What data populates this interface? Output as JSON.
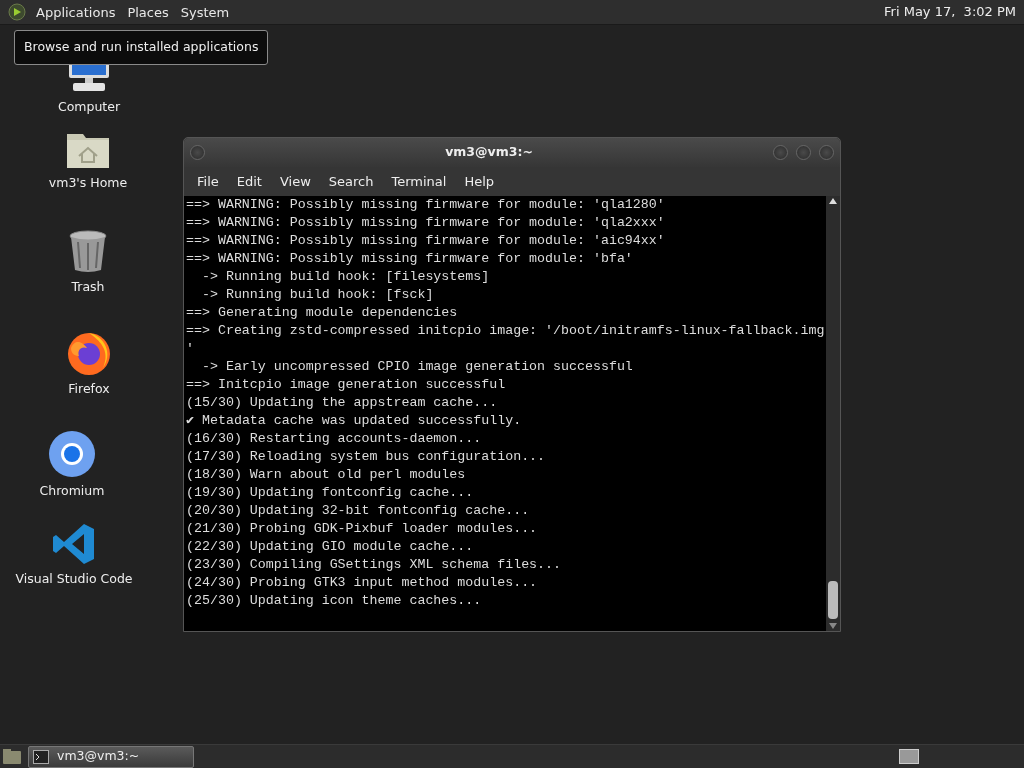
{
  "top_panel": {
    "menus": [
      "Applications",
      "Places",
      "System"
    ],
    "clock": "Fri May 17,  3:02 PM"
  },
  "tooltip": "Browse and run installed applications",
  "desktop_icons": [
    {
      "kind": "computer",
      "label": "Computer"
    },
    {
      "kind": "home",
      "label": "vm3's Home"
    },
    {
      "kind": "trash",
      "label": "Trash"
    },
    {
      "kind": "firefox",
      "label": "Firefox"
    },
    {
      "kind": "chromium",
      "label": "Chromium"
    },
    {
      "kind": "vscode",
      "label": "Visual Studio Code"
    }
  ],
  "terminal": {
    "title": "vm3@vm3:~",
    "menu": [
      "File",
      "Edit",
      "View",
      "Search",
      "Terminal",
      "Help"
    ],
    "lines": [
      "==> WARNING: Possibly missing firmware for module: 'qla1280'",
      "==> WARNING: Possibly missing firmware for module: 'qla2xxx'",
      "==> WARNING: Possibly missing firmware for module: 'aic94xx'",
      "==> WARNING: Possibly missing firmware for module: 'bfa'",
      "  -> Running build hook: [filesystems]",
      "  -> Running build hook: [fsck]",
      "==> Generating module dependencies",
      "==> Creating zstd-compressed initcpio image: '/boot/initramfs-linux-fallback.img",
      "'",
      "  -> Early uncompressed CPIO image generation successful",
      "==> Initcpio image generation successful",
      "(15/30) Updating the appstream cache...",
      "✔ Metadata cache was updated successfully.",
      "(16/30) Restarting accounts-daemon...",
      "(17/30) Reloading system bus configuration...",
      "(18/30) Warn about old perl modules",
      "(19/30) Updating fontconfig cache...",
      "(20/30) Updating 32-bit fontconfig cache...",
      "(21/30) Probing GDK-Pixbuf loader modules...",
      "(22/30) Updating GIO module cache...",
      "(23/30) Compiling GSettings XML schema files...",
      "(24/30) Probing GTK3 input method modules...",
      "(25/30) Updating icon theme caches..."
    ]
  },
  "taskbar": {
    "windows": [
      {
        "title": "vm3@vm3:~",
        "selected": true
      }
    ]
  }
}
